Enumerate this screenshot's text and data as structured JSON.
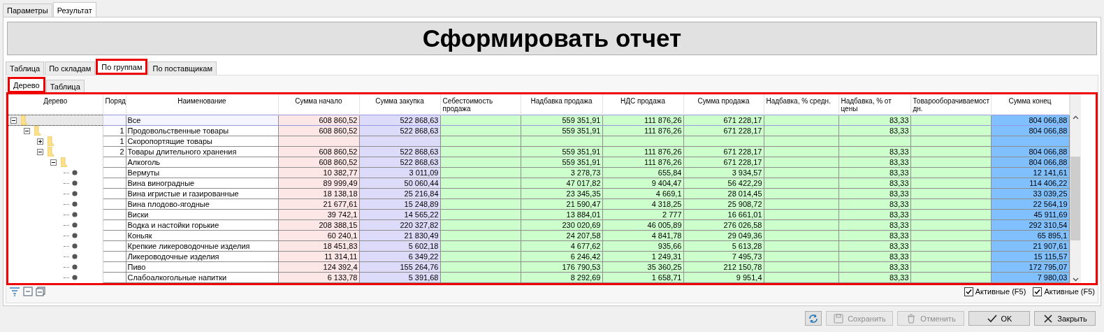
{
  "top_tabs": [
    {
      "label": "Параметры",
      "selected": false
    },
    {
      "label": "Результат",
      "selected": true
    }
  ],
  "report_button": {
    "label": "Сформировать отчет"
  },
  "view_tabs": [
    {
      "label": "Таблица",
      "selected": false,
      "highlighted": false
    },
    {
      "label": "По складам",
      "selected": false,
      "highlighted": false
    },
    {
      "label": "По группам",
      "selected": true,
      "highlighted": true
    },
    {
      "label": "По поставщикам",
      "selected": false,
      "highlighted": false
    }
  ],
  "sub_tabs": [
    {
      "label": "Дерево",
      "selected": true,
      "highlighted": true
    },
    {
      "label": "Таблица",
      "selected": false,
      "highlighted": false
    }
  ],
  "grid": {
    "highlighted": true,
    "columns": [
      {
        "label": "Дерево",
        "kind": "tree"
      },
      {
        "label": "Поряд",
        "kind": "order"
      },
      {
        "label": "Наименование",
        "kind": "name"
      },
      {
        "label": "Сумма начало",
        "kind": "value",
        "color": "#fde6e6"
      },
      {
        "label": "Сумма закупка",
        "kind": "value",
        "color": "#dcdcfa"
      },
      {
        "label": "Себестоимость продажа",
        "kind": "value",
        "color": "#ccffcc"
      },
      {
        "label": "Надбавка продажа",
        "kind": "value",
        "color": "#ccffcc"
      },
      {
        "label": "НДС продажа",
        "kind": "value",
        "color": "#ccffcc"
      },
      {
        "label": "Сумма продажа",
        "kind": "value",
        "color": "#ccffcc"
      },
      {
        "label": "Надбавка, % средн.",
        "kind": "value",
        "color": "#ccffcc"
      },
      {
        "label": "Надбавка, % от цены",
        "kind": "value",
        "color": "#ccffcc"
      },
      {
        "label": "Товарооборачиваемост дн.",
        "kind": "value",
        "color": "#ccffcc"
      },
      {
        "label": "Сумма конец",
        "kind": "value",
        "color": "#80c0ff"
      }
    ],
    "rows": [
      {
        "kind": "group",
        "expanded": true,
        "selected": true,
        "cells": [
          "",
          "",
          "Все",
          "608 860,52",
          "522 868,63",
          "",
          "559 351,91",
          "111 876,26",
          "671 228,17",
          "",
          "83,33",
          "",
          "804 066,88"
        ],
        "children": [
          {
            "kind": "group",
            "expanded": true,
            "selected": false,
            "cells": [
              "",
              "1",
              "Продовольственные товары",
              "608 860,52",
              "522 868,63",
              "",
              "559 351,91",
              "111 876,26",
              "671 228,17",
              "",
              "83,33",
              "",
              "804 066,88"
            ],
            "children": [
              {
                "kind": "group",
                "expanded": false,
                "selected": false,
                "cells": [
                  "",
                  "1",
                  "Скоропортящие товары",
                  "",
                  "",
                  "",
                  "",
                  "",
                  "",
                  "",
                  "",
                  "",
                  ""
                ]
              },
              {
                "kind": "group",
                "expanded": true,
                "selected": false,
                "cells": [
                  "",
                  "2",
                  "Товары длительного хранения",
                  "608 860,52",
                  "522 868,63",
                  "",
                  "559 351,91",
                  "111 876,26",
                  "671 228,17",
                  "",
                  "83,33",
                  "",
                  "804 066,88"
                ],
                "children": [
                  {
                    "kind": "group",
                    "expanded": true,
                    "selected": false,
                    "cells": [
                      "",
                      "",
                      "Алкоголь",
                      "608 860,52",
                      "522 868,63",
                      "",
                      "559 351,91",
                      "111 876,26",
                      "671 228,17",
                      "",
                      "83,33",
                      "",
                      "804 066,88"
                    ],
                    "children": [
                      {
                        "kind": "item",
                        "selected": false,
                        "cells": [
                          "",
                          "",
                          "Вермуты",
                          "10 382,77",
                          "3 011,09",
                          "",
                          "3 278,73",
                          "655,84",
                          "3 934,57",
                          "",
                          "83,33",
                          "",
                          "12 141,61"
                        ]
                      },
                      {
                        "kind": "item",
                        "selected": false,
                        "cells": [
                          "",
                          "",
                          "Вина виноградные",
                          "89 999,49",
                          "50 060,44",
                          "",
                          "47 017,82",
                          "9 404,47",
                          "56 422,29",
                          "",
                          "83,33",
                          "",
                          "114 406,22"
                        ]
                      },
                      {
                        "kind": "item",
                        "selected": false,
                        "cells": [
                          "",
                          "",
                          "Вина игристые и газированные",
                          "18 138,18",
                          "25 216,84",
                          "",
                          "23 345,35",
                          "4 669,1",
                          "28 014,45",
                          "",
                          "83,33",
                          "",
                          "33 039,25"
                        ]
                      },
                      {
                        "kind": "item",
                        "selected": false,
                        "cells": [
                          "",
                          "",
                          "Вина плодово-ягодные",
                          "21 677,61",
                          "15 248,89",
                          "",
                          "21 590,47",
                          "4 318,25",
                          "25 908,72",
                          "",
                          "83,33",
                          "",
                          "22 564,19"
                        ]
                      },
                      {
                        "kind": "item",
                        "selected": false,
                        "cells": [
                          "",
                          "",
                          "Виски",
                          "39 742,1",
                          "14 565,22",
                          "",
                          "13 884,01",
                          "2 777",
                          "16 661,01",
                          "",
                          "83,33",
                          "",
                          "45 911,69"
                        ]
                      },
                      {
                        "kind": "item",
                        "selected": false,
                        "cells": [
                          "",
                          "",
                          "Водка и настойки горькие",
                          "208 388,15",
                          "220 327,82",
                          "",
                          "230 020,69",
                          "46 005,89",
                          "276 026,58",
                          "",
                          "83,33",
                          "",
                          "292 310,54"
                        ]
                      },
                      {
                        "kind": "item",
                        "selected": false,
                        "cells": [
                          "",
                          "",
                          "Коньяк",
                          "60 240,1",
                          "21 830,49",
                          "",
                          "24 207,58",
                          "4 841,78",
                          "29 049,36",
                          "",
                          "83,33",
                          "",
                          "65 895,1"
                        ]
                      },
                      {
                        "kind": "item",
                        "selected": false,
                        "cells": [
                          "",
                          "",
                          "Крепкие ликероводочные изделия",
                          "18 451,83",
                          "5 602,18",
                          "",
                          "4 677,62",
                          "935,66",
                          "5 613,28",
                          "",
                          "83,33",
                          "",
                          "21 907,61"
                        ]
                      },
                      {
                        "kind": "item",
                        "selected": false,
                        "cells": [
                          "",
                          "",
                          "Ликероводочные изделия",
                          "11 314,11",
                          "6 349,22",
                          "",
                          "6 246,42",
                          "1 249,31",
                          "7 495,73",
                          "",
                          "83,33",
                          "",
                          "15 115,57"
                        ]
                      },
                      {
                        "kind": "item",
                        "selected": false,
                        "cells": [
                          "",
                          "",
                          "Пиво",
                          "124 392,4",
                          "155 264,76",
                          "",
                          "176 790,53",
                          "35 360,25",
                          "212 150,78",
                          "",
                          "83,33",
                          "",
                          "172 795,07"
                        ]
                      },
                      {
                        "kind": "item",
                        "selected": false,
                        "cells": [
                          "",
                          "",
                          "Слабоалкогольные напитки",
                          "6 133,78",
                          "5 391,68",
                          "",
                          "8 292,69",
                          "1 658,71",
                          "9 951,4",
                          "",
                          "83,33",
                          "",
                          "7 980,03"
                        ]
                      }
                    ]
                  }
                ]
              }
            ]
          }
        ]
      }
    ]
  },
  "filters": [
    {
      "label": "Активные (F5)",
      "checked": true
    },
    {
      "label": "Активные (F5)",
      "checked": true
    }
  ],
  "buttons": [
    {
      "kind": "refresh",
      "disabled": false
    },
    {
      "kind": "save",
      "label": "Сохранить",
      "disabled": true
    },
    {
      "kind": "delete",
      "label": "Отменить",
      "disabled": true
    },
    {
      "kind": "ok",
      "label": "OK",
      "disabled": false
    },
    {
      "kind": "close",
      "label": "Закрыть",
      "disabled": false
    }
  ]
}
